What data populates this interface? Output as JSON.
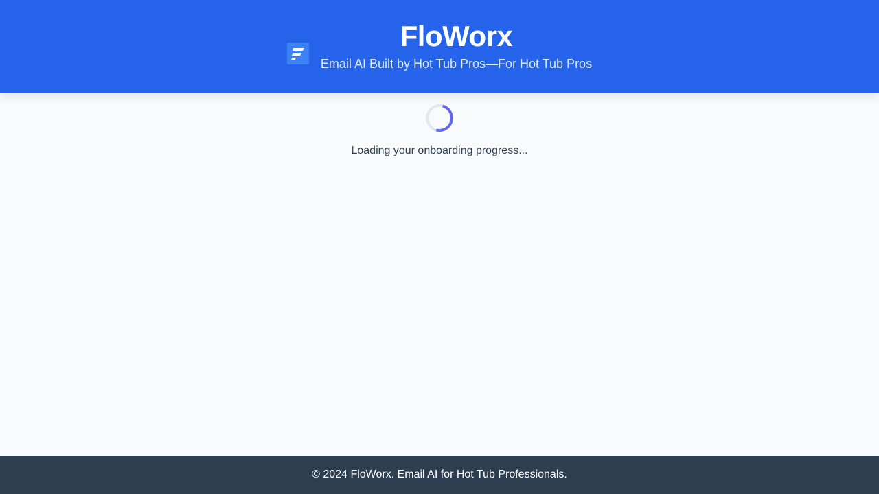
{
  "header": {
    "title": "FloWorx",
    "tagline": "Email AI Built by Hot Tub Pros—For Hot Tub Pros",
    "logo_icon": "floworx-logo-icon"
  },
  "main": {
    "loading_text": "Loading your onboarding progress...",
    "spinner_icon": "loading-spinner-icon"
  },
  "footer": {
    "text": "© 2024 FloWorx. Email AI for Hot Tub Professionals."
  },
  "colors": {
    "header_bg": "#2563eb",
    "page_bg": "#f8fafc",
    "footer_bg": "#2d3e50",
    "spinner_accent": "#6366f1"
  }
}
